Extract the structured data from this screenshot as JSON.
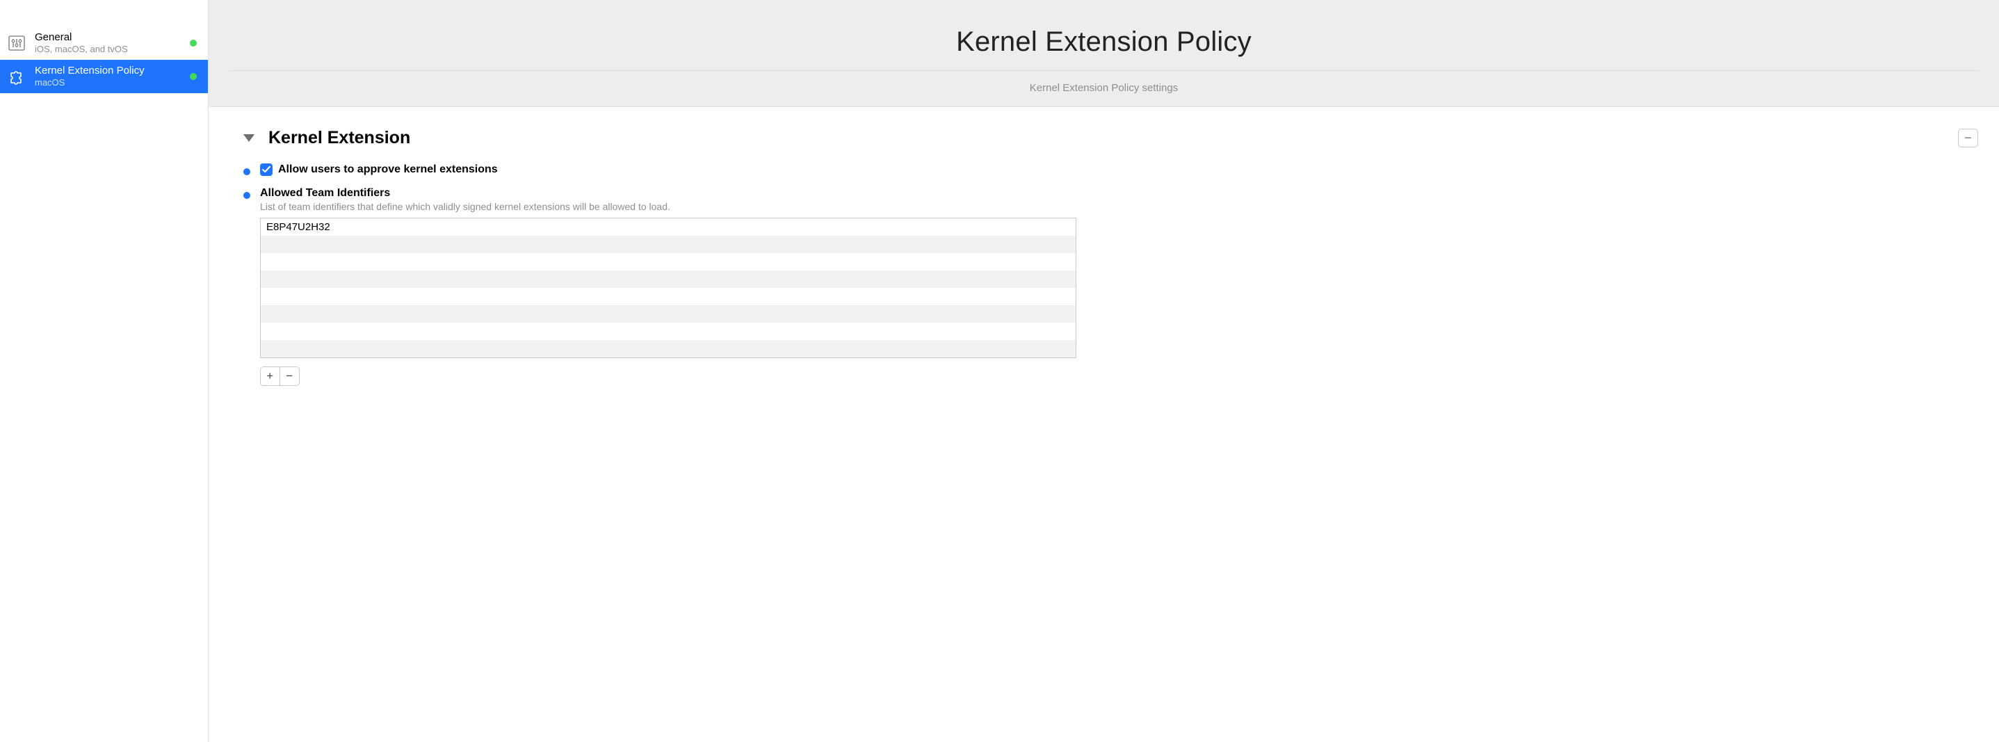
{
  "sidebar": {
    "items": [
      {
        "title": "General",
        "subtitle": "iOS, macOS, and tvOS",
        "selected": false,
        "configured": true,
        "icon": "sliders"
      },
      {
        "title": "Kernel Extension Policy",
        "subtitle": "macOS",
        "selected": true,
        "configured": true,
        "icon": "puzzle"
      }
    ]
  },
  "header": {
    "title": "Kernel Extension Policy",
    "subtitle": "Kernel Extension Policy settings"
  },
  "section": {
    "title": "Kernel Extension",
    "remove_label": "−",
    "allow_users": {
      "checked": true,
      "label": "Allow users to approve kernel extensions"
    },
    "team_ids": {
      "title": "Allowed Team Identifiers",
      "description": "List of team identifiers that define which validly signed kernel extensions will be allowed to load.",
      "rows": [
        "E8P47U2H32",
        "",
        "",
        "",
        "",
        "",
        "",
        ""
      ]
    },
    "add_label": "+",
    "del_label": "−"
  }
}
